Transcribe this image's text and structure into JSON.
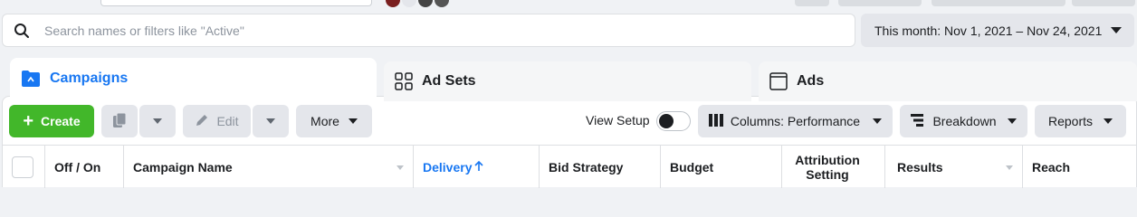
{
  "search": {
    "placeholder": "Search names or filters like \"Active\""
  },
  "date_range": {
    "label": "This month: Nov 1, 2021 – Nov 24, 2021"
  },
  "tabs": [
    {
      "label": "Campaigns",
      "active": true,
      "icon": "folder-icon"
    },
    {
      "label": "Ad Sets",
      "active": false,
      "icon": "grid-icon"
    },
    {
      "label": "Ads",
      "active": false,
      "icon": "ad-frame-icon"
    }
  ],
  "toolbar": {
    "create_label": "Create",
    "edit_label": "Edit",
    "more_label": "More",
    "view_setup_label": "View Setup",
    "columns_label": "Columns: Performance",
    "breakdown_label": "Breakdown",
    "reports_label": "Reports"
  },
  "table": {
    "headers": [
      {
        "label": "Off / On"
      },
      {
        "label": "Campaign Name"
      },
      {
        "label": "Delivery"
      },
      {
        "label": "Bid Strategy"
      },
      {
        "label": "Budget"
      },
      {
        "label": "Attribution Setting"
      },
      {
        "label": "Results"
      },
      {
        "label": "Reach"
      }
    ]
  },
  "colors": {
    "accent": "#1877f2",
    "create_green": "#42b72a",
    "button_gray": "#e4e6eb",
    "background": "#f0f2f5"
  }
}
